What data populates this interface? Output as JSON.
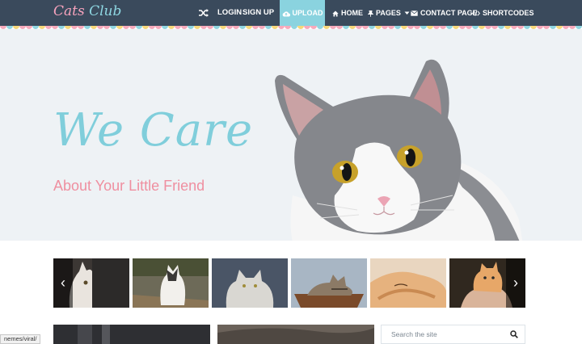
{
  "logo": {
    "word1": "Cats",
    "word2": "Club"
  },
  "nav": {
    "shuffle_icon": "shuffle-icon",
    "login": "LOGIN",
    "signup": "SIGN UP",
    "upload": "UPLOAD",
    "home": "HOME",
    "pages": "PAGES",
    "contact": "CONTACT PAGE",
    "shortcodes": "SHORTCODES"
  },
  "hero": {
    "title": "We Care",
    "subtitle": "About Your Little Friend"
  },
  "carousel": {
    "prev_icon": "chevron-left-icon",
    "next_icon": "chevron-right-icon",
    "prev": "‹",
    "next": "›"
  },
  "search": {
    "placeholder": "Search the site"
  },
  "status": {
    "url": "nemes/viral/"
  },
  "colors": {
    "nav_bg": "#3a4a5c",
    "accent_blue": "#80cedb",
    "accent_pink": "#ef8fa0",
    "hero_bg": "#eef2f5"
  }
}
